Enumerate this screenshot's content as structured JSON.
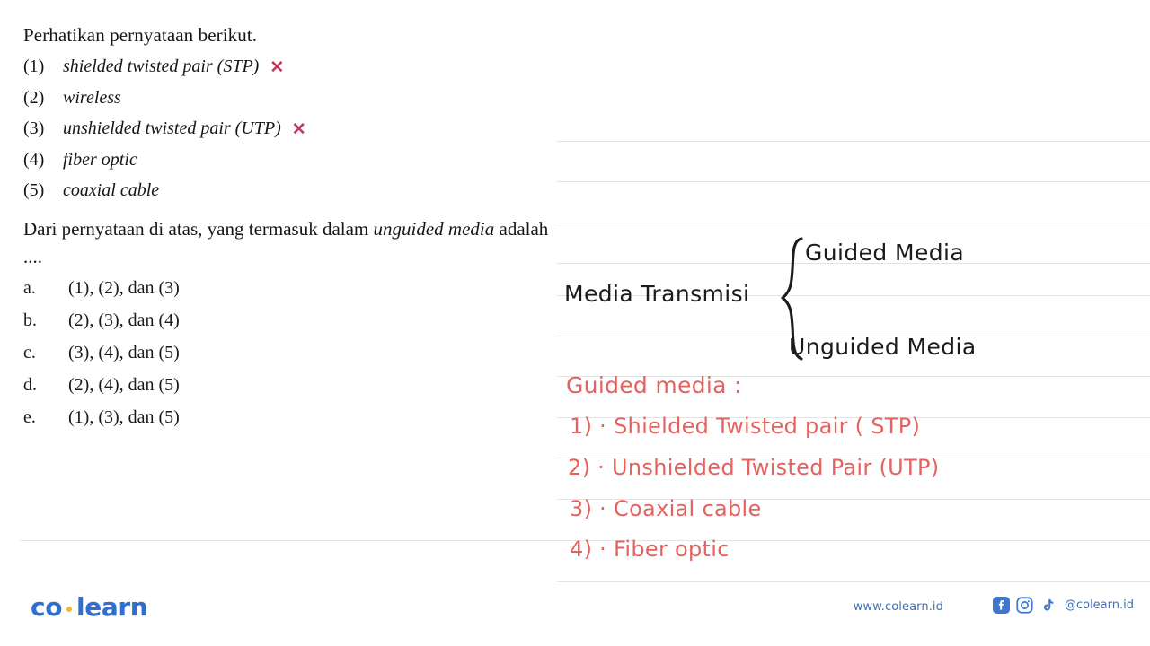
{
  "page": {
    "intro": "Perhatikan pernyataan berikut.",
    "statements": [
      {
        "num": "(1)",
        "text": "shielded twisted pair (STP)",
        "mark": "✕"
      },
      {
        "num": "(2)",
        "text": "wireless",
        "mark": ""
      },
      {
        "num": "(3)",
        "text": "unshielded twisted pair (UTP)",
        "mark": "✕"
      },
      {
        "num": "(4)",
        "text": "fiber optic",
        "mark": ""
      },
      {
        "num": "(5)",
        "text": "coaxial cable",
        "mark": ""
      }
    ],
    "question_part1": "Dari pernyataan di atas, yang termasuk dalam ",
    "question_italic1": "unguided",
    "question_italic2": "media",
    "question_part2": " adalah ....",
    "choices": [
      {
        "key": "a.",
        "value": "(1), (2), dan (3)"
      },
      {
        "key": "b.",
        "value": "(2), (3), dan (4)"
      },
      {
        "key": "c.",
        "value": "(3), (4), dan (5)"
      },
      {
        "key": "d.",
        "value": "(2), (4), dan (5)"
      },
      {
        "key": "e.",
        "value": "(1), (3), dan (5)"
      }
    ]
  },
  "annotation": {
    "black": {
      "root_label": "Media Transmisi",
      "branch_top": "Guided Media",
      "branch_bottom": "Unguided Media",
      "brace": "}"
    },
    "red": {
      "heading": "Guided media :",
      "items": [
        "1) · Shielded Twisted pair ( STP)",
        "2) · Unshielded Twisted Pair (UTP)",
        "3) · Coaxial cable",
        "4) · Fiber optic"
      ]
    }
  },
  "footer": {
    "logo_part1": "co",
    "logo_part2": "learn",
    "url": "www.colearn.id",
    "handle": "@colearn.id",
    "icons": [
      "facebook-icon",
      "instagram-icon",
      "tiktok-icon"
    ]
  },
  "colors": {
    "brand_blue": "#2f6fd0",
    "brand_dot": "#f5b52b",
    "hand_red": "#e4625f",
    "mark_red": "#c2375a",
    "rule_gray": "#e2e4e6"
  }
}
